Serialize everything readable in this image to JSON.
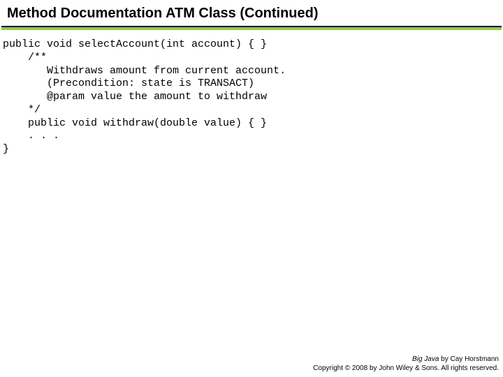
{
  "title": "Method Documentation ATM Class (Continued)",
  "code": {
    "l1": "public void selectAccount(int account) { }",
    "l2": "    /**",
    "l3": "       Withdraws amount from current account.",
    "l4": "       (Precondition: state is TRANSACT)",
    "l5": "       @param value the amount to withdraw",
    "l6": "    */",
    "l7": "    public void withdraw(double value) { }",
    "l8": "    . . .",
    "l9": "}"
  },
  "footer": {
    "book": "Big Java",
    "by": " by Cay Horstmann",
    "copyright": "Copyright © 2008 by John Wiley & Sons. All rights reserved."
  }
}
